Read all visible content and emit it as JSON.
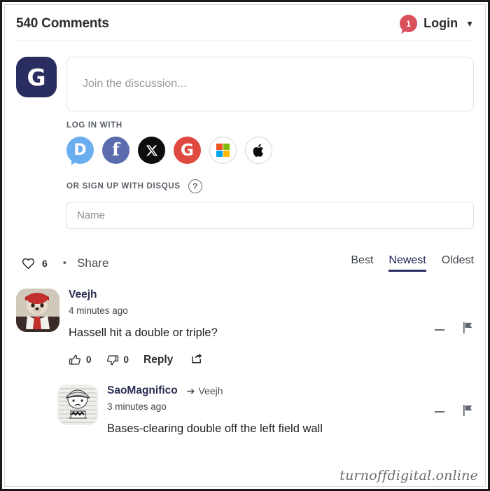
{
  "header": {
    "title": "540 Comments",
    "notification_count": "1",
    "login_label": "Login",
    "caret": "▼"
  },
  "composer": {
    "avatar_initial": "G",
    "placeholder": "Join the discussion..."
  },
  "login_with": {
    "label": "LOG IN WITH",
    "providers": [
      {
        "name": "disqus",
        "glyph": "D",
        "color": "#6aaef0"
      },
      {
        "name": "facebook",
        "glyph": "f",
        "color": "#5a6cad"
      },
      {
        "name": "x-twitter",
        "glyph": "𝕏",
        "color": "#0d0d0d"
      },
      {
        "name": "google",
        "glyph": "G",
        "color": "#e0493f"
      },
      {
        "name": "microsoft",
        "glyph": "",
        "color": "#ffffff"
      },
      {
        "name": "apple",
        "glyph": "",
        "color": "#ffffff"
      }
    ],
    "microsoft_squares": [
      "#f25022",
      "#7fba00",
      "#00a4ef",
      "#ffb900"
    ]
  },
  "signup": {
    "label": "OR SIGN UP WITH DISQUS",
    "help_glyph": "?",
    "name_placeholder": "Name"
  },
  "meta": {
    "likes": "6",
    "separator": "•",
    "share_label": "Share"
  },
  "sort": {
    "options": [
      {
        "label": "Best",
        "active": false
      },
      {
        "label": "Newest",
        "active": true
      },
      {
        "label": "Oldest",
        "active": false
      }
    ]
  },
  "comments": [
    {
      "author": "Veejh",
      "time": "4 minutes ago",
      "text": "Hassell hit a double or triple?",
      "upvotes": "0",
      "downvotes": "0",
      "reply_label": "Reply",
      "parent": null
    },
    {
      "author": "SaoMagnifico",
      "time": "3 minutes ago",
      "text": "Bases-clearing double off the left field wall",
      "parent": "Veejh",
      "parent_arrow": "➔"
    }
  ],
  "watermark": "turnoffdigital.online",
  "colors": {
    "accent": "#2a2d60",
    "badge": "#d9515c",
    "text": "#1d2022"
  }
}
